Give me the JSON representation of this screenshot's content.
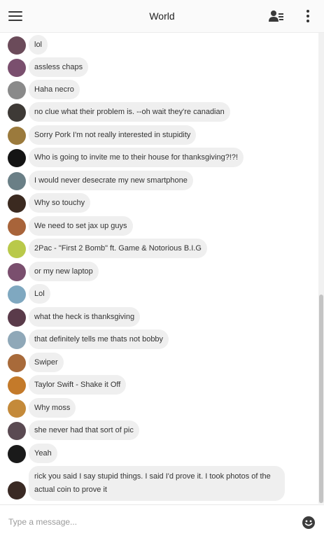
{
  "header": {
    "title": "World",
    "menu_icon": "hamburger-menu-icon",
    "participants_icon": "people-list-icon",
    "more_icon": "more-vert-icon"
  },
  "messages": [
    {
      "text": "lol",
      "avatar_color": "#6b4b5a"
    },
    {
      "text": "assless chaps",
      "avatar_color": "#7a4f6e"
    },
    {
      "text": "Haha necro",
      "avatar_color": "#8a8a8a"
    },
    {
      "text": "no clue what their problem is. --oh wait they're canadian",
      "avatar_color": "#3e3a36"
    },
    {
      "text": "Sorry Pork I'm not really interested in stupidity",
      "avatar_color": "#9b7a3c"
    },
    {
      "text": "Who is going to invite me to their house for thanksgiving?!?!",
      "avatar_color": "#141414"
    },
    {
      "text": "I would never desecrate my new smartphone",
      "avatar_color": "#6a7f86"
    },
    {
      "text": "Why so touchy",
      "avatar_color": "#3b2a20"
    },
    {
      "text": "We need to set jax up guys",
      "avatar_color": "#a8643a"
    },
    {
      "text": "2Pac - \"First 2 Bomb\" ft. Game & Notorious B.I.G",
      "avatar_color": "#b9c94a"
    },
    {
      "text": "or my new laptop",
      "avatar_color": "#7a4f6e"
    },
    {
      "text": "Lol",
      "avatar_color": "#7fa8c0"
    },
    {
      "text": "what the heck is thanksgiving",
      "avatar_color": "#5a3b4a"
    },
    {
      "text": "that definitely tells me thats not bobby",
      "avatar_color": "#8fa8b8"
    },
    {
      "text": "Swiper",
      "avatar_color": "#a86a3a"
    },
    {
      "text": "Taylor Swift - Shake it Off",
      "avatar_color": "#c47a2a"
    },
    {
      "text": "Why moss",
      "avatar_color": "#c48a3a"
    },
    {
      "text": "she never had that sort of pic",
      "avatar_color": "#5a4a52"
    },
    {
      "text": "Yeah",
      "avatar_color": "#1a1a1a"
    },
    {
      "text": "rick you said I say stupid things. I said I'd prove it. I took photos of the actual coin to prove it",
      "avatar_color": "#3a2a24"
    }
  ],
  "composer": {
    "placeholder": "Type a message...",
    "emoji_icon": "emoji-smiley-icon"
  }
}
